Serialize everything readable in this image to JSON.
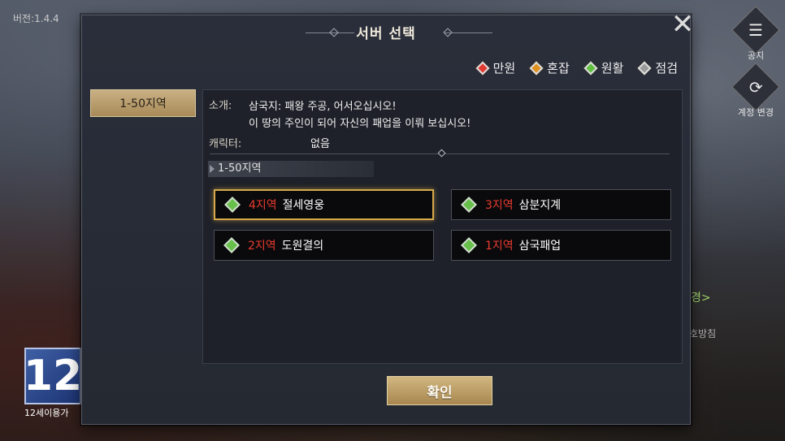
{
  "version": "버전:1.4.4",
  "side_buttons": {
    "notice_label": "공지",
    "account_label": "계정 변경"
  },
  "background_texts": {
    "text1": "경>",
    "text2": "호방침"
  },
  "age_badge": {
    "number": "12",
    "label": "12세이용가"
  },
  "dialog": {
    "title": "서버 선택",
    "close_icon": "close-x",
    "legend": [
      {
        "label": "만원",
        "color": "#e23a30"
      },
      {
        "label": "혼잡",
        "color": "#e0921f"
      },
      {
        "label": "원활",
        "color": "#5fbf3f"
      },
      {
        "label": "점검",
        "color": "#9a9a9a"
      }
    ],
    "region_tab": "1-50지역",
    "intro_label": "소개:",
    "intro_line1": "삼국지: 패왕 주공, 어서오십시오!",
    "intro_line2": "이 땅의 주인이 되어 자신의 패업을 이뤄 보십시오!",
    "character_label": "캐릭터:",
    "character_value": "없음",
    "group_header": "1-50지역",
    "servers": [
      {
        "num": "4지역",
        "name": "절세영웅",
        "status_color": "#5fbf3f",
        "selected": true
      },
      {
        "num": "3지역",
        "name": "삼분지계",
        "status_color": "#5fbf3f",
        "selected": false
      },
      {
        "num": "2지역",
        "name": "도원결의",
        "status_color": "#5fbf3f",
        "selected": false
      },
      {
        "num": "1지역",
        "name": "삼국패업",
        "status_color": "#5fbf3f",
        "selected": false
      }
    ],
    "confirm_label": "확인"
  }
}
